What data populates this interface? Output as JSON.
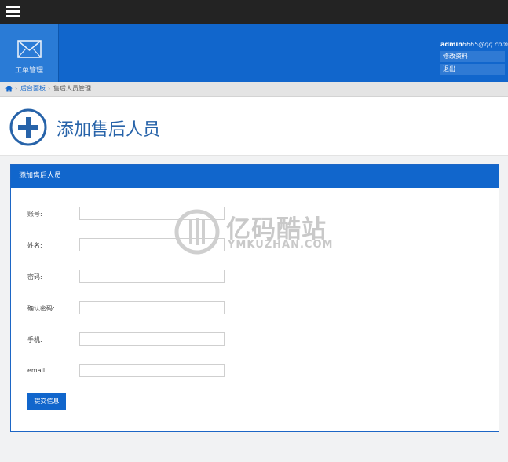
{
  "nav": {
    "tile_label": "工单管理"
  },
  "user": {
    "name": "admin",
    "email_suffix": "6665@qq.com",
    "links": [
      "修改资料",
      "退出"
    ]
  },
  "breadcrumb": {
    "items": [
      "后台面板",
      "售后人员管理"
    ]
  },
  "page": {
    "title": "添加售后人员"
  },
  "panel": {
    "title": "添加售后人员"
  },
  "form": {
    "fields": [
      {
        "label": "账号:",
        "value": "",
        "placeholder": ""
      },
      {
        "label": "姓名:",
        "value": "",
        "placeholder": ""
      },
      {
        "label": "密码:",
        "value": "",
        "placeholder": ""
      },
      {
        "label": "确认密码:",
        "value": "",
        "placeholder": ""
      },
      {
        "label": "手机:",
        "value": "",
        "placeholder": ""
      },
      {
        "label": "email:",
        "value": "",
        "placeholder": ""
      }
    ],
    "submit_label": "提交信息"
  },
  "watermark": {
    "cn": "亿码酷站",
    "en": "YMKUZHAN.COM"
  },
  "colors": {
    "topbar": "#232323",
    "brand_blue": "#1166cc",
    "title_blue": "#2763a9"
  }
}
